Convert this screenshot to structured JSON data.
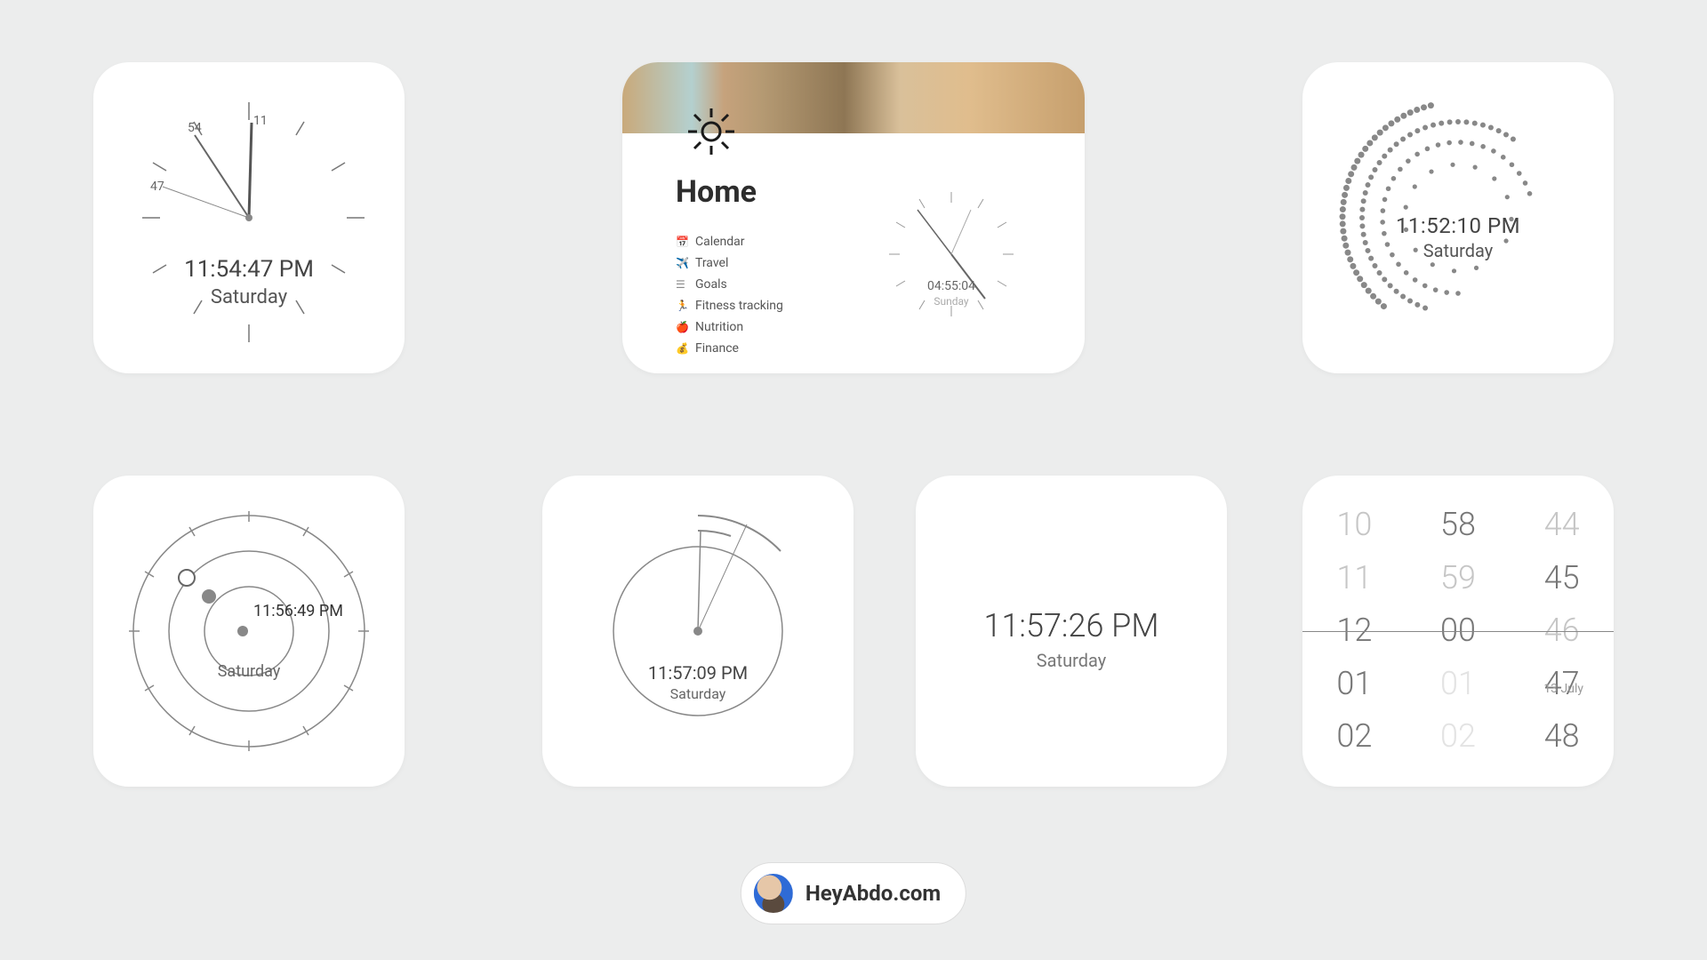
{
  "card1": {
    "time": "11:54:47 PM",
    "day": "Saturday",
    "label_54": "54",
    "label_47": "47",
    "label_11": "11"
  },
  "card2": {
    "title": "Home",
    "mini_time": "04:55:04",
    "mini_day": "Sunday",
    "nav": [
      {
        "icon": "📅",
        "label": "Calendar"
      },
      {
        "icon": "✈️",
        "label": "Travel"
      },
      {
        "icon": "☰",
        "label": "Goals"
      },
      {
        "icon": "🏃",
        "label": "Fitness tracking"
      },
      {
        "icon": "🍎",
        "label": "Nutrition"
      },
      {
        "icon": "💰",
        "label": "Finance"
      }
    ]
  },
  "card3": {
    "time": "11:52:10 PM",
    "day": "Saturday"
  },
  "card4": {
    "time": "11:56:49 PM",
    "day": "Saturday"
  },
  "card5": {
    "time": "11:57:09 PM",
    "day": "Saturday"
  },
  "card6": {
    "time": "11:57:26 PM",
    "day": "Saturday"
  },
  "card7": {
    "hours": [
      "10",
      "11",
      "12",
      "01",
      "02"
    ],
    "minutes": [
      "58",
      "59",
      "00"
    ],
    "seconds": [
      "44",
      "45",
      "46",
      "47",
      "48"
    ],
    "date": "13 July"
  },
  "footer": {
    "site": "HeyAbdo.com"
  }
}
